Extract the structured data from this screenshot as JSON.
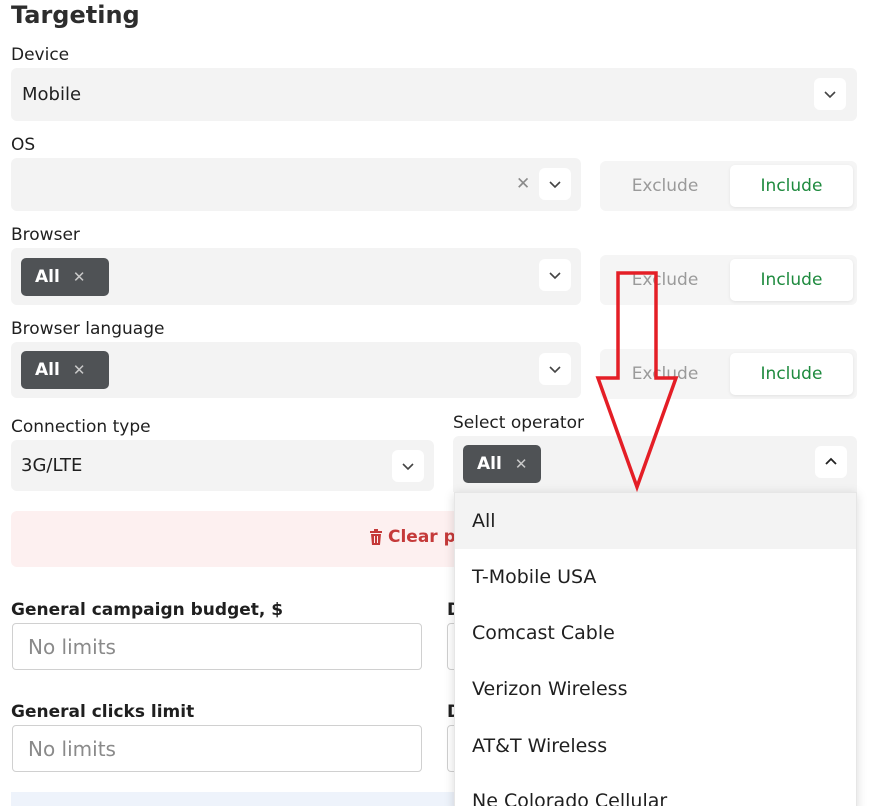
{
  "title": "Targeting",
  "device": {
    "label": "Device",
    "value": "Mobile"
  },
  "os": {
    "label": "OS",
    "toggle": {
      "exclude": "Exclude",
      "include": "Include"
    }
  },
  "browser": {
    "label": "Browser",
    "tag": "All",
    "toggle": {
      "exclude": "Exclude",
      "include": "Include"
    }
  },
  "browser_language": {
    "label": "Browser language",
    "tag": "All",
    "toggle": {
      "exclude": "Exclude",
      "include": "Include"
    }
  },
  "connection_type": {
    "label": "Connection type",
    "value": "3G/LTE"
  },
  "operator": {
    "label": "Select operator",
    "tag": "All",
    "options": [
      "All",
      "T-Mobile USA",
      "Comcast Cable",
      "Verizon Wireless",
      "AT&T Wireless",
      "Ne Colorado Cellular"
    ]
  },
  "clear": {
    "label": "Clear pa"
  },
  "budget": {
    "label": "General campaign budget, $",
    "placeholder": "No limits",
    "right_label_fragment": "D"
  },
  "clicks": {
    "label": "General clicks limit",
    "placeholder": "No limits",
    "right_label_fragment": "D"
  },
  "colors": {
    "include_text": "#1e8a3e",
    "tag_bg": "#4f5255",
    "clear_text": "#c53a3a",
    "arrow": "#e41e26"
  }
}
